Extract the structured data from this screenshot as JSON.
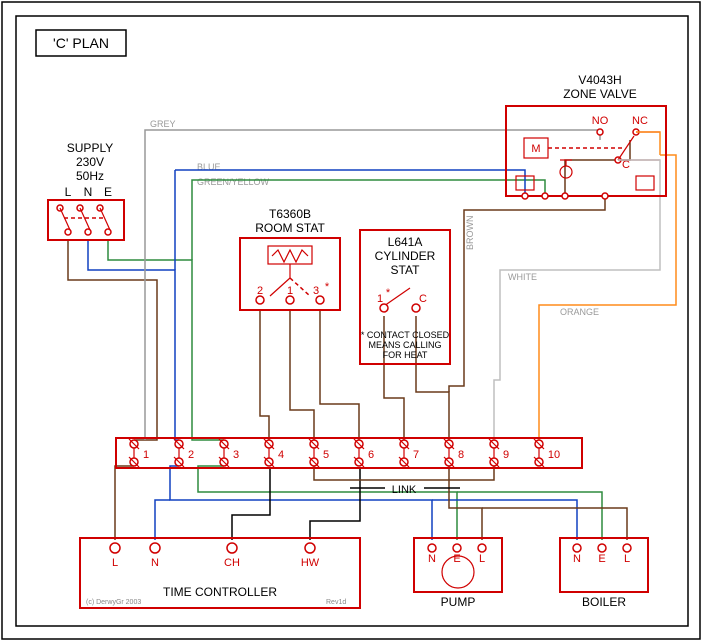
{
  "title": "'C' PLAN",
  "supply": {
    "label1": "SUPPLY",
    "label2": "230V",
    "label3": "50Hz",
    "terminals": [
      "L",
      "N",
      "E"
    ]
  },
  "room_stat": {
    "label1": "T6360B",
    "label2": "ROOM STAT",
    "terminals": [
      "2",
      "1",
      "3"
    ],
    "note_star": "*"
  },
  "cyl_stat": {
    "label1": "L641A",
    "label2": "CYLINDER",
    "label3": "STAT",
    "terminals": [
      "1",
      "C"
    ],
    "note_star": "*",
    "note1": "* CONTACT CLOSED",
    "note2": "MEANS CALLING",
    "note3": "FOR HEAT"
  },
  "zone_valve": {
    "label1": "V4043H",
    "label2": "ZONE VALVE",
    "m": "M",
    "no": "NO",
    "nc": "NC",
    "c": "C"
  },
  "junction": {
    "terminals": [
      "1",
      "2",
      "3",
      "4",
      "5",
      "6",
      "7",
      "8",
      "9",
      "10"
    ],
    "link": "LINK"
  },
  "time_controller": {
    "label": "TIME CONTROLLER",
    "terminals": [
      "L",
      "N",
      "CH",
      "HW"
    ]
  },
  "pump": {
    "label": "PUMP",
    "terminals": [
      "N",
      "E",
      "L"
    ]
  },
  "boiler": {
    "label": "BOILER",
    "terminals": [
      "N",
      "E",
      "L"
    ]
  },
  "wire_labels": {
    "grey": "GREY",
    "blue": "BLUE",
    "gy": "GREEN/YELLOW",
    "brown": "BROWN",
    "white": "WHITE",
    "orange": "ORANGE"
  },
  "footer": {
    "copyright": "(c) DerwyGr 2003",
    "rev": "Rev1d"
  }
}
